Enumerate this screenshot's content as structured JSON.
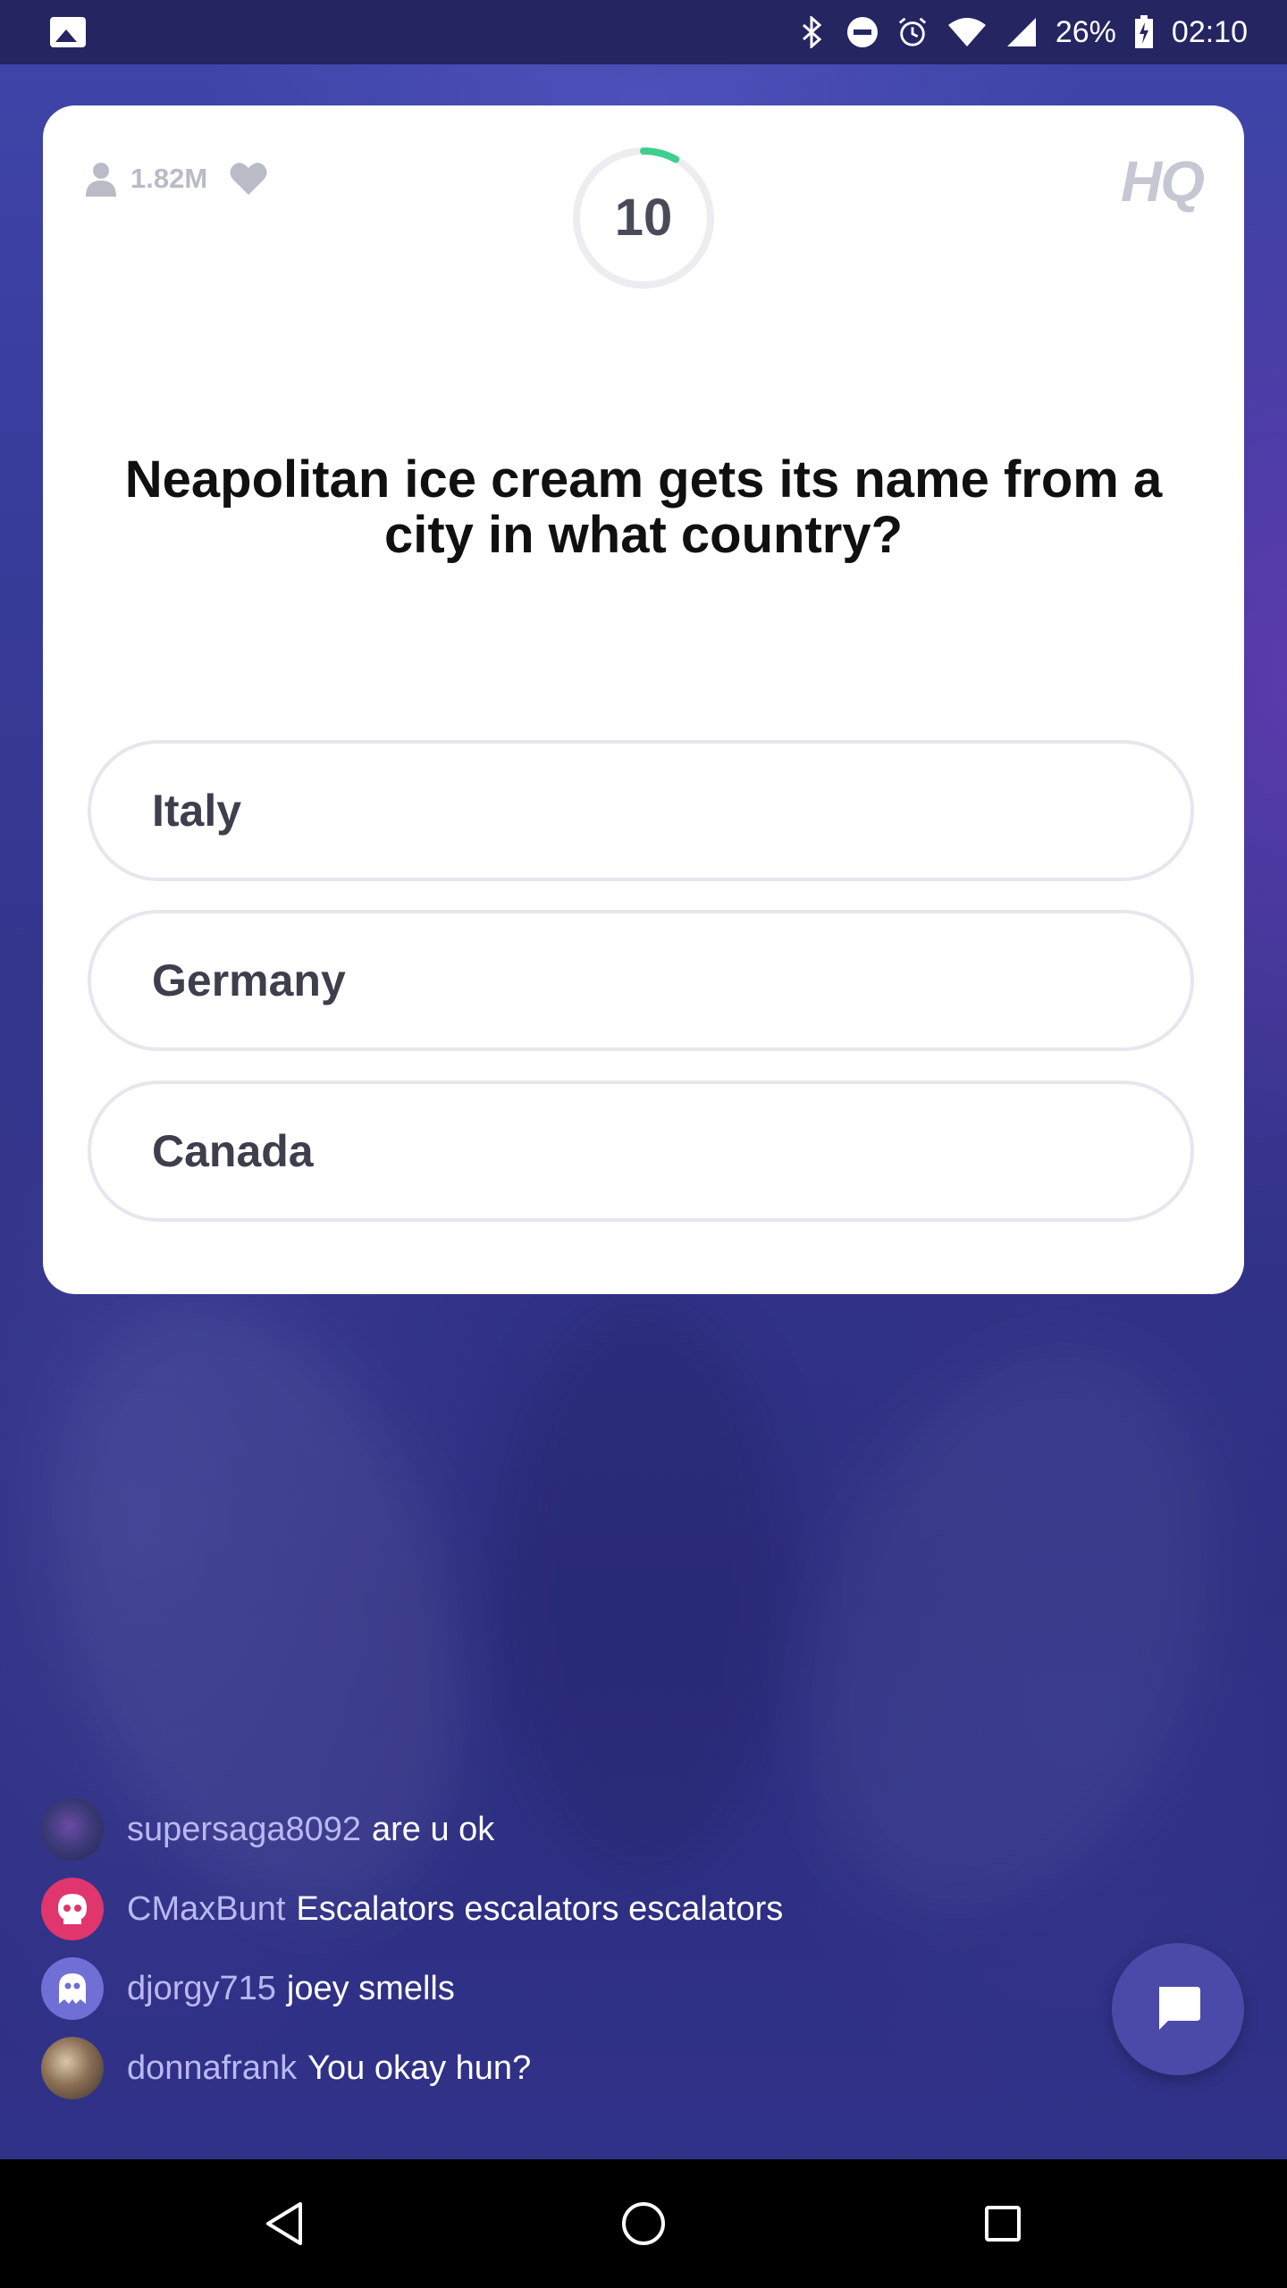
{
  "status_bar": {
    "battery": "26%",
    "time": "02:10",
    "icons": [
      "gallery-icon",
      "bluetooth-icon",
      "do-not-disturb-icon",
      "alarm-icon",
      "wifi-icon",
      "signal-icon",
      "battery-charging-icon"
    ]
  },
  "game": {
    "viewer_count": "1.82M",
    "timer": "10",
    "logo": "HQ",
    "question": "Neapolitan ice cream gets its name from a city in what country?",
    "answers": [
      "Italy",
      "Germany",
      "Canada"
    ],
    "timer_progress": 0.08
  },
  "chat": {
    "messages": [
      {
        "user": "supersaga8092",
        "text": "are u ok"
      },
      {
        "user": "CMaxBunt",
        "text": "Escalators escalators escalators"
      },
      {
        "user": "djorgy715",
        "text": "joey smells"
      },
      {
        "user": "donnafrank",
        "text": "You okay hun?"
      }
    ]
  },
  "colors": {
    "accent_timer": "#3ecf8e",
    "chat_username": "#b9b8f2",
    "background": "#33358c"
  }
}
